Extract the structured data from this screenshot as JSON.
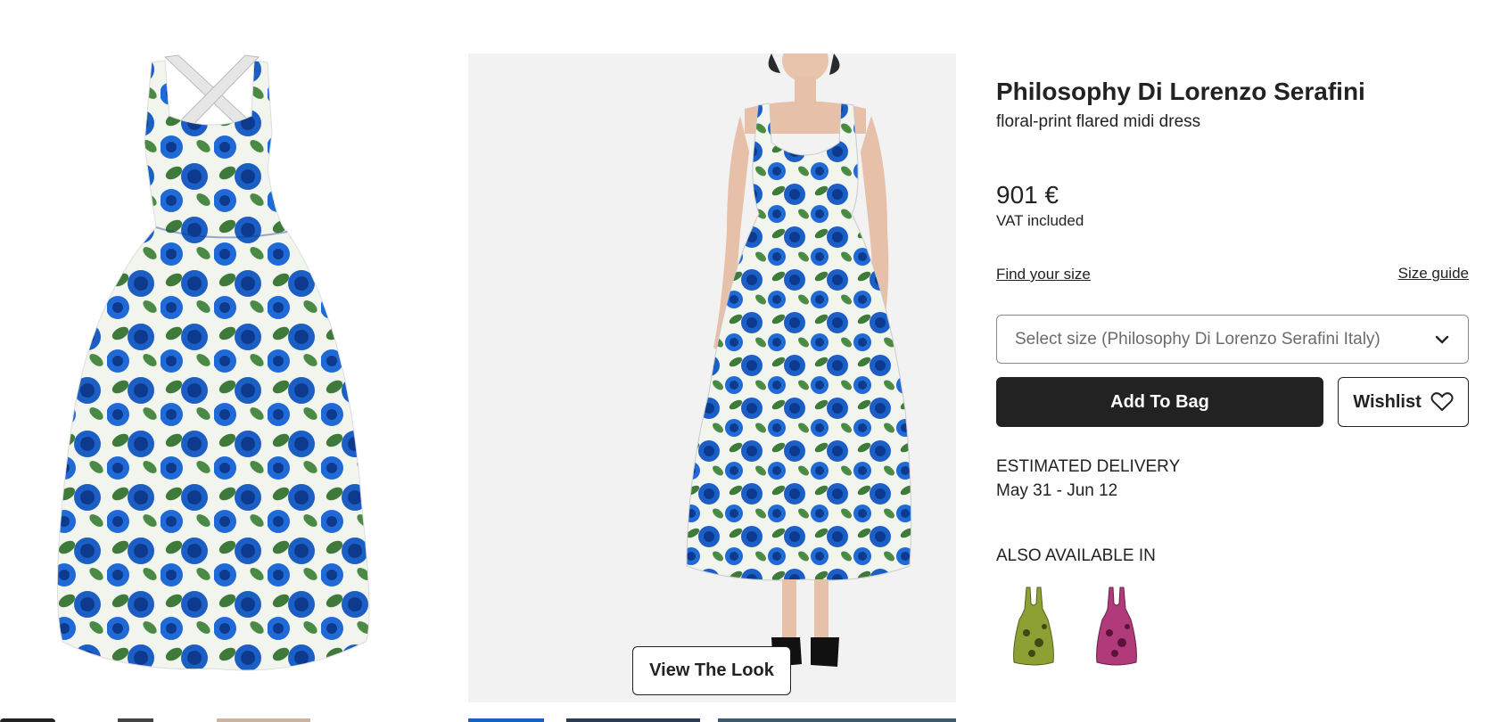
{
  "product": {
    "brand": "Philosophy Di Lorenzo Serafini",
    "name": "floral-print flared midi dress",
    "price": "901 €",
    "vat_note": "VAT included"
  },
  "sizing": {
    "find_size_label": "Find your size",
    "size_guide_label": "Size guide",
    "select_placeholder": "Select size (Philosophy Di Lorenzo Serafini Italy)"
  },
  "actions": {
    "add_to_bag_label": "Add To Bag",
    "wishlist_label": "Wishlist"
  },
  "delivery": {
    "title": "ESTIMATED DELIVERY",
    "dates": "May 31 - Jun 12"
  },
  "also_available": {
    "title": "ALSO AVAILABLE IN",
    "variants": [
      {
        "color_name": "green",
        "color": "#8da033"
      },
      {
        "color_name": "pink",
        "color": "#b03a7a"
      }
    ]
  },
  "gallery": {
    "view_look_label": "View The Look",
    "dress_colors": {
      "base": "#f2f4ee",
      "rose_blue": "#1c5fc4",
      "rose_dark": "#0d3a8c",
      "leaf_green": "#3f7a3a"
    }
  },
  "icons": {
    "wishlist": "heart-icon",
    "select": "chevron-down-icon"
  }
}
